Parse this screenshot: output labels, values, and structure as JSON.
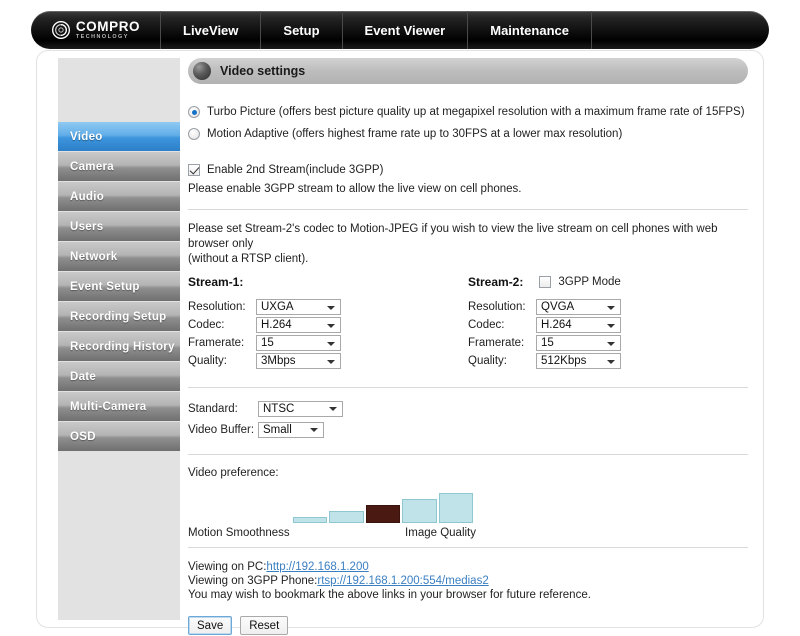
{
  "nav": {
    "logo": {
      "name": "COMPRO",
      "sub": "TECHNOLOGY",
      "icon": "compro-swirl-logo-icon"
    },
    "items": [
      {
        "label": "LiveView"
      },
      {
        "label": "Setup"
      },
      {
        "label": "Event Viewer"
      },
      {
        "label": "Maintenance"
      }
    ]
  },
  "sidebar": {
    "items": [
      {
        "label": "Video",
        "active": true
      },
      {
        "label": "Camera",
        "active": false
      },
      {
        "label": "Audio",
        "active": false
      },
      {
        "label": "Users",
        "active": false
      },
      {
        "label": "Network",
        "active": false
      },
      {
        "label": "Event Setup",
        "active": false
      },
      {
        "label": "Recording Setup",
        "active": false
      },
      {
        "label": "Recording History",
        "active": false
      },
      {
        "label": "Date",
        "active": false
      },
      {
        "label": "Multi-Camera",
        "active": false
      },
      {
        "label": "OSD",
        "active": false
      }
    ]
  },
  "section": {
    "title": "Video settings",
    "orb_icon": "sphere-bullet-icon"
  },
  "mode": {
    "options": [
      {
        "label": "Turbo Picture (offers best picture quality up at megapixel resolution with a maximum frame rate of 15FPS)",
        "checked": true
      },
      {
        "label": "Motion Adaptive (offers highest frame rate up to 30FPS at a lower max resolution)",
        "checked": false
      }
    ]
  },
  "second_stream": {
    "checkbox_label": "Enable 2nd Stream(include 3GPP)",
    "checked": true,
    "note": "Please enable 3GPP stream to allow the live view on cell phones."
  },
  "codec_note_line1": "Please set Stream-2's codec to Motion-JPEG if you wish to view the live stream on cell phones with web browser only",
  "codec_note_line2": "(without a RTSP client).",
  "stream1": {
    "title": "Stream-1:",
    "fields": [
      {
        "label": "Resolution:",
        "value": "UXGA"
      },
      {
        "label": "Codec:",
        "value": "H.264"
      },
      {
        "label": "Framerate:",
        "value": "15"
      },
      {
        "label": "Quality:",
        "value": "3Mbps"
      }
    ]
  },
  "stream2": {
    "title": "Stream-2:",
    "mode_label": "3GPP Mode",
    "mode_checked": false,
    "fields": [
      {
        "label": "Resolution:",
        "value": "QVGA"
      },
      {
        "label": "Codec:",
        "value": "H.264"
      },
      {
        "label": "Framerate:",
        "value": "15"
      },
      {
        "label": "Quality:",
        "value": "512Kbps"
      }
    ]
  },
  "general": {
    "standard_label": "Standard:",
    "standard_value": "NTSC",
    "buffer_label": "Video Buffer:",
    "buffer_value": "Small"
  },
  "preference": {
    "label": "Video preference:",
    "left_end": "Motion Smoothness",
    "right_end": "Image Quality",
    "segments": 5,
    "selected_index": 2,
    "bar_color": "#bfe3e8",
    "selected_color": "#4a1a12"
  },
  "links": {
    "pc_prefix": "Viewing on PC:",
    "pc_url": "http://192.168.1.200",
    "phone_prefix": "Viewing on 3GPP Phone:",
    "phone_url": "rtsp://192.168.1.200:554/medias2",
    "bookmark_note": "You may wish to bookmark the above links in your browser for future reference."
  },
  "buttons": {
    "save": "Save",
    "reset": "Reset"
  }
}
